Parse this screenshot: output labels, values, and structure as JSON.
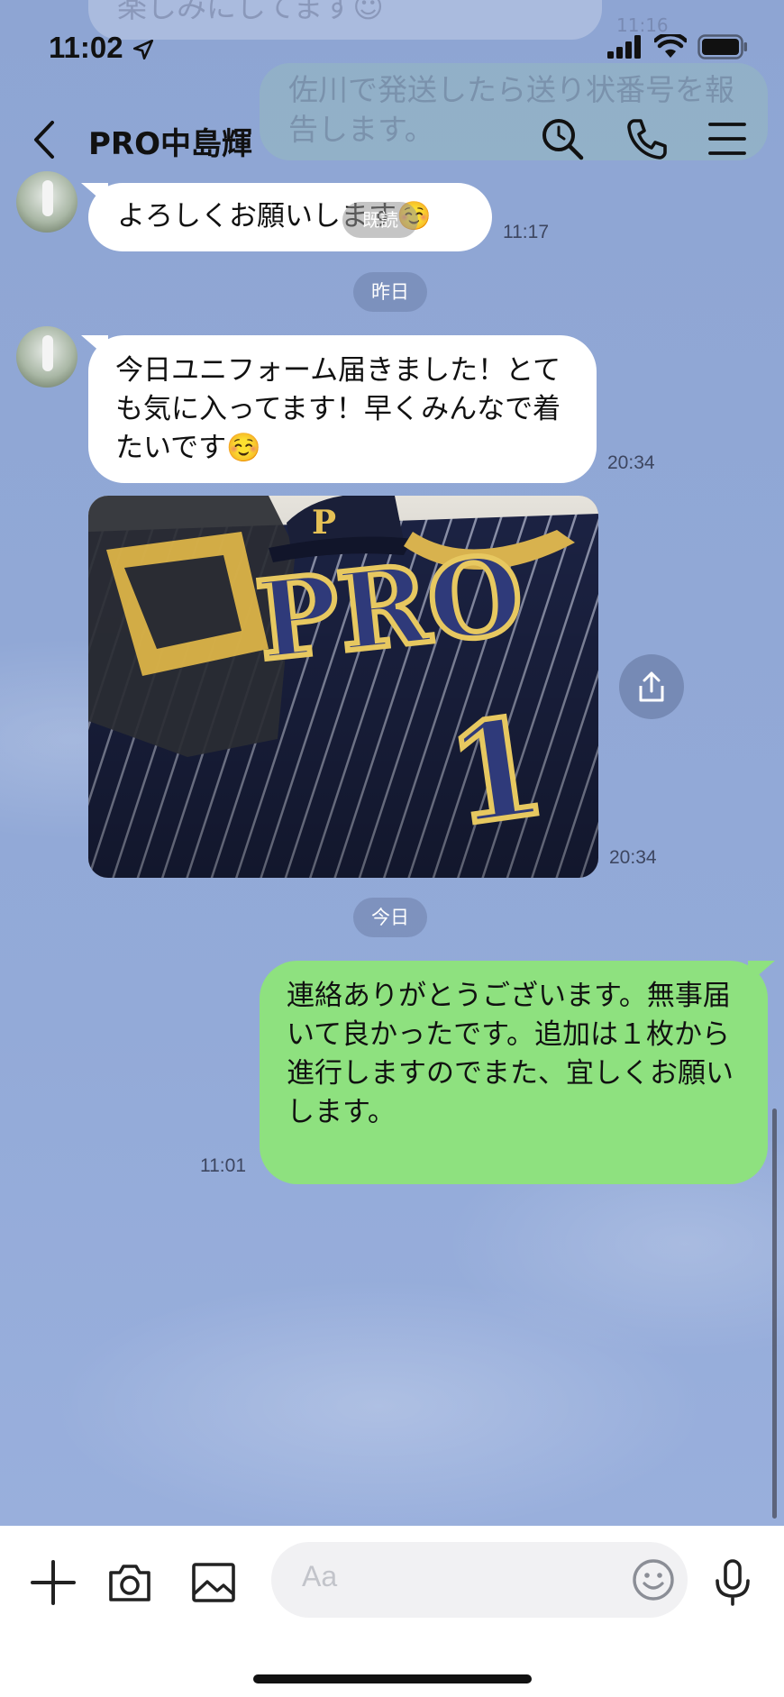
{
  "status_bar": {
    "time": "11:02"
  },
  "header": {
    "title": "PRO中島輝"
  },
  "ghost": {
    "top_text": "楽しみにしてます☺",
    "top_time": "11:16",
    "right_text": "佐川で発送したら送り状番号を報告します。",
    "read_label": "既読"
  },
  "messages": [
    {
      "text": "よろしくお願いします☺️",
      "time": "11:17"
    },
    {
      "date": "昨日"
    },
    {
      "text": "今日ユニフォーム届きました！とても気に入ってます！早くみんなで着たいです☺️",
      "time": "20:34"
    },
    {
      "photo_time": "20:34"
    },
    {
      "date": "今日"
    },
    {
      "text": "連絡ありがとうございます。無事届いて良かったです。追加は１枚から進行しますのでまた、宜しくお願いします。",
      "time": "11:01"
    }
  ],
  "photo": {
    "letters": "PRO",
    "number": "1",
    "cap_letter": "P"
  },
  "input": {
    "placeholder": "Aa"
  },
  "colors": {
    "background": "#8fa6d4",
    "outgoing_bubble": "#8ee17f",
    "incoming_bubble": "#ffffff"
  }
}
